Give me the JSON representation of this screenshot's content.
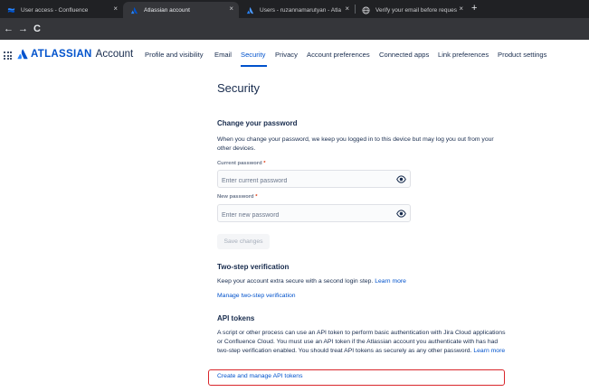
{
  "browser": {
    "tabs": [
      {
        "label": "User access - Confluence",
        "active": false
      },
      {
        "label": "Atlassian account",
        "active": true
      },
      {
        "label": "Users - ruzannamarutyan - Atla",
        "active": false
      },
      {
        "label": "Verify your email before reques",
        "active": false
      }
    ],
    "new_tab": "+",
    "close": "×",
    "nav": {
      "back": "←",
      "forward": "→",
      "reload": "C"
    }
  },
  "header": {
    "brand": "ATLASSIAN",
    "product": "Account",
    "tabs": [
      {
        "label": "Profile and visibility",
        "active": false
      },
      {
        "label": "Email",
        "active": false
      },
      {
        "label": "Security",
        "active": true
      },
      {
        "label": "Privacy",
        "active": false
      },
      {
        "label": "Account preferences",
        "active": false
      },
      {
        "label": "Connected apps",
        "active": false
      },
      {
        "label": "Link preferences",
        "active": false
      },
      {
        "label": "Product settings",
        "active": false
      }
    ]
  },
  "main": {
    "title": "Security",
    "change_password": {
      "heading": "Change your password",
      "description": "When you change your password, we keep you logged in to this device but may log you out from your other devices.",
      "current": {
        "label": "Current password",
        "required": "*",
        "placeholder": "Enter current password"
      },
      "new": {
        "label": "New password",
        "required": "*",
        "placeholder": "Enter new password"
      },
      "save_label": "Save changes"
    },
    "two_step": {
      "heading": "Two-step verification",
      "description": "Keep your account extra secure with a second login step.",
      "learn_more": "Learn more",
      "manage_link": "Manage two-step verification"
    },
    "api_tokens": {
      "heading": "API tokens",
      "description": "A script or other process can use an API token to perform basic authentication with Jira Cloud applications or Confluence Cloud. You must use an API token if the Atlassian account you authenticate with has had two-step verification enabled. You should treat API tokens as securely as any other password.",
      "learn_more": "Learn more",
      "manage_link": "Create and manage API tokens"
    }
  },
  "colors": {
    "accent": "#0052cc",
    "highlight": "#d9262b",
    "text": "#172b4d"
  }
}
